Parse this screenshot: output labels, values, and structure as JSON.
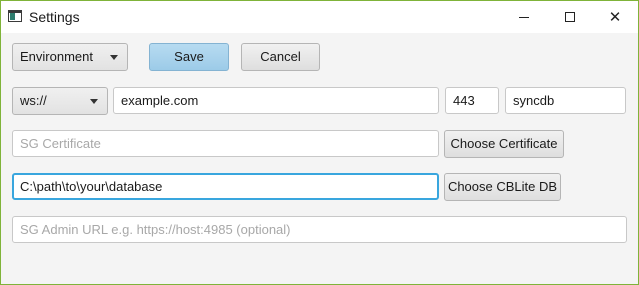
{
  "window": {
    "title": "Settings"
  },
  "toolbar": {
    "environment_label": "Environment",
    "save_label": "Save",
    "cancel_label": "Cancel"
  },
  "connection": {
    "scheme_value": "ws://",
    "host_value": "example.com",
    "port_value": "443",
    "database_value": "syncdb"
  },
  "certificate": {
    "placeholder": "SG Certificate",
    "button_label": "Choose Certificate"
  },
  "cblite": {
    "path_value": "C:\\path\\to\\your\\database",
    "button_label": "Choose CBLite DB"
  },
  "admin": {
    "placeholder": "SG Admin URL e.g. https://host:4985 (optional)"
  },
  "colors": {
    "primary_button": "#a6d0ea",
    "focus_border": "#39a6de",
    "window_border": "#7fb339"
  }
}
